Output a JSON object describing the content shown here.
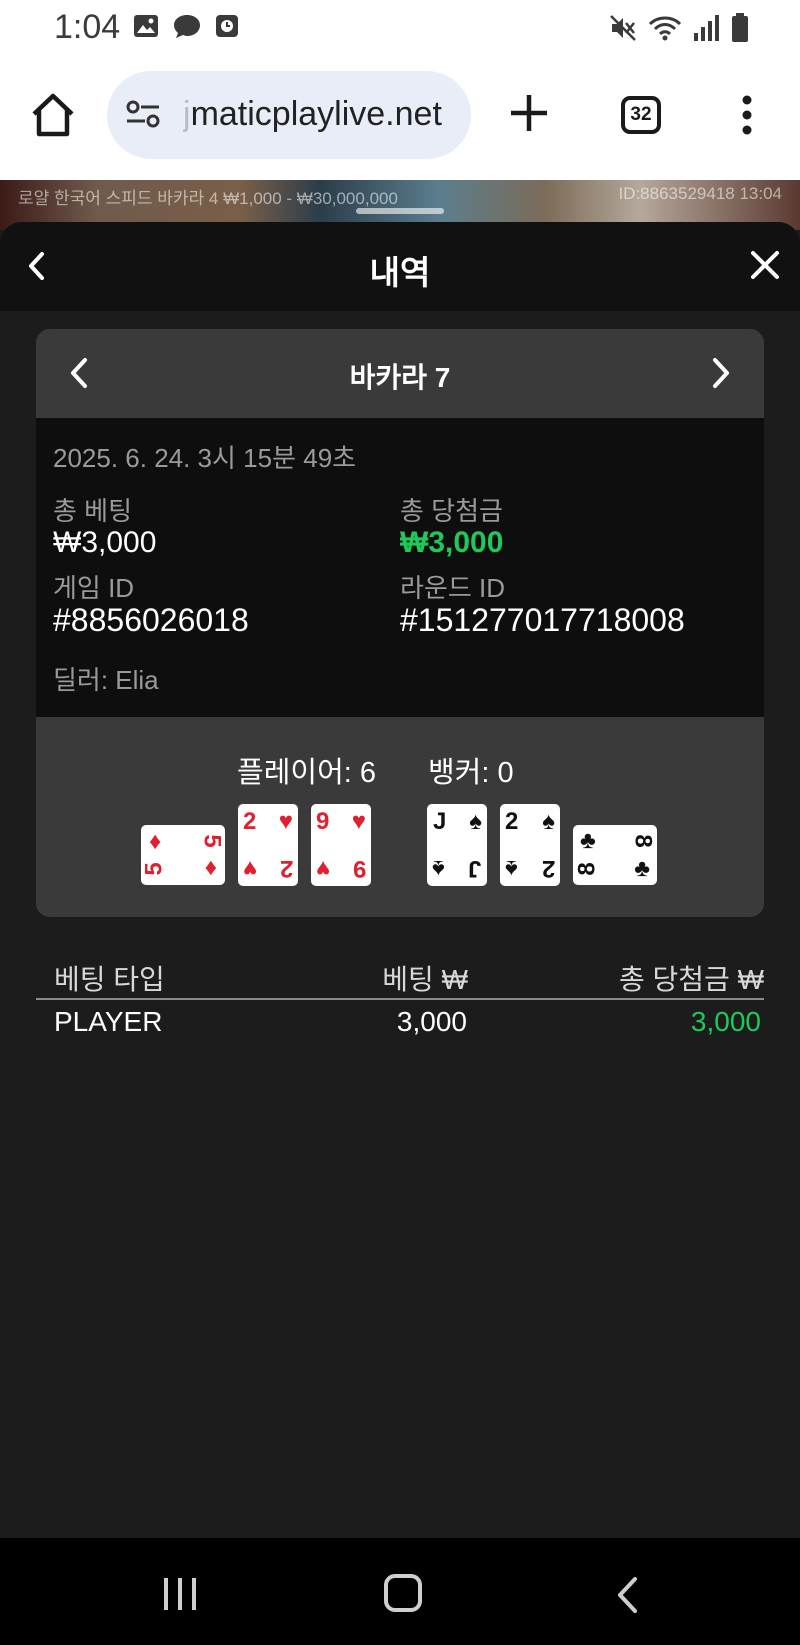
{
  "status_bar": {
    "time": "1:04",
    "left_icons": [
      "image-icon",
      "chat-bubble-icon",
      "clock-badge-icon"
    ],
    "right_icons": [
      "mute-icon",
      "wifi-icon",
      "signal-icon",
      "battery-icon"
    ]
  },
  "browser": {
    "url_fade": "j",
    "url": "maticplaylive.net",
    "tab_count": "32"
  },
  "game_strip": {
    "info": "로얄 한국어 스피드 바카라 4   ₩1,000 - ₩30,000,000",
    "id_time": "ID:8863529418   13:04"
  },
  "sheet": {
    "title": "내역"
  },
  "round": {
    "title": "바카라 7",
    "date": "2025. 6. 24. 3시 15분 49초",
    "total_bet_label": "총 베팅",
    "total_bet_value": "₩3,000",
    "total_win_label": "총 당첨금",
    "total_win_value": "₩3,000",
    "game_id_label": "게임 ID",
    "game_id_value": "#8856026018",
    "round_id_label": "라운드 ID",
    "round_id_value": "#151277017718008",
    "dealer": "딜러: Elia"
  },
  "hands": {
    "player_label": "플레이어: 6",
    "banker_label": "뱅커: 0",
    "player_cards": [
      {
        "rank": "5",
        "suit": "♦",
        "color": "#e0202f",
        "orientation": "sideways"
      },
      {
        "rank": "2",
        "suit": "♥",
        "color": "#e0202f",
        "orientation": "upright"
      },
      {
        "rank": "9",
        "suit": "♥",
        "color": "#e0202f",
        "orientation": "upright"
      }
    ],
    "banker_cards": [
      {
        "rank": "J",
        "suit": "♠",
        "color": "#111111",
        "orientation": "upright"
      },
      {
        "rank": "2",
        "suit": "♠",
        "color": "#111111",
        "orientation": "upright"
      },
      {
        "rank": "8",
        "suit": "♣",
        "color": "#111111",
        "orientation": "sideways"
      }
    ]
  },
  "bets_table": {
    "headers": [
      "베팅 타입",
      "베팅 ₩",
      "총 당첨금 ₩"
    ],
    "rows": [
      {
        "type": "PLAYER",
        "bet": "3,000",
        "win": "3,000"
      }
    ]
  },
  "colors": {
    "win_green": "#1fc85a",
    "sheet_bg": "#1c1c1c",
    "card_panel": "#3a3a3a"
  }
}
